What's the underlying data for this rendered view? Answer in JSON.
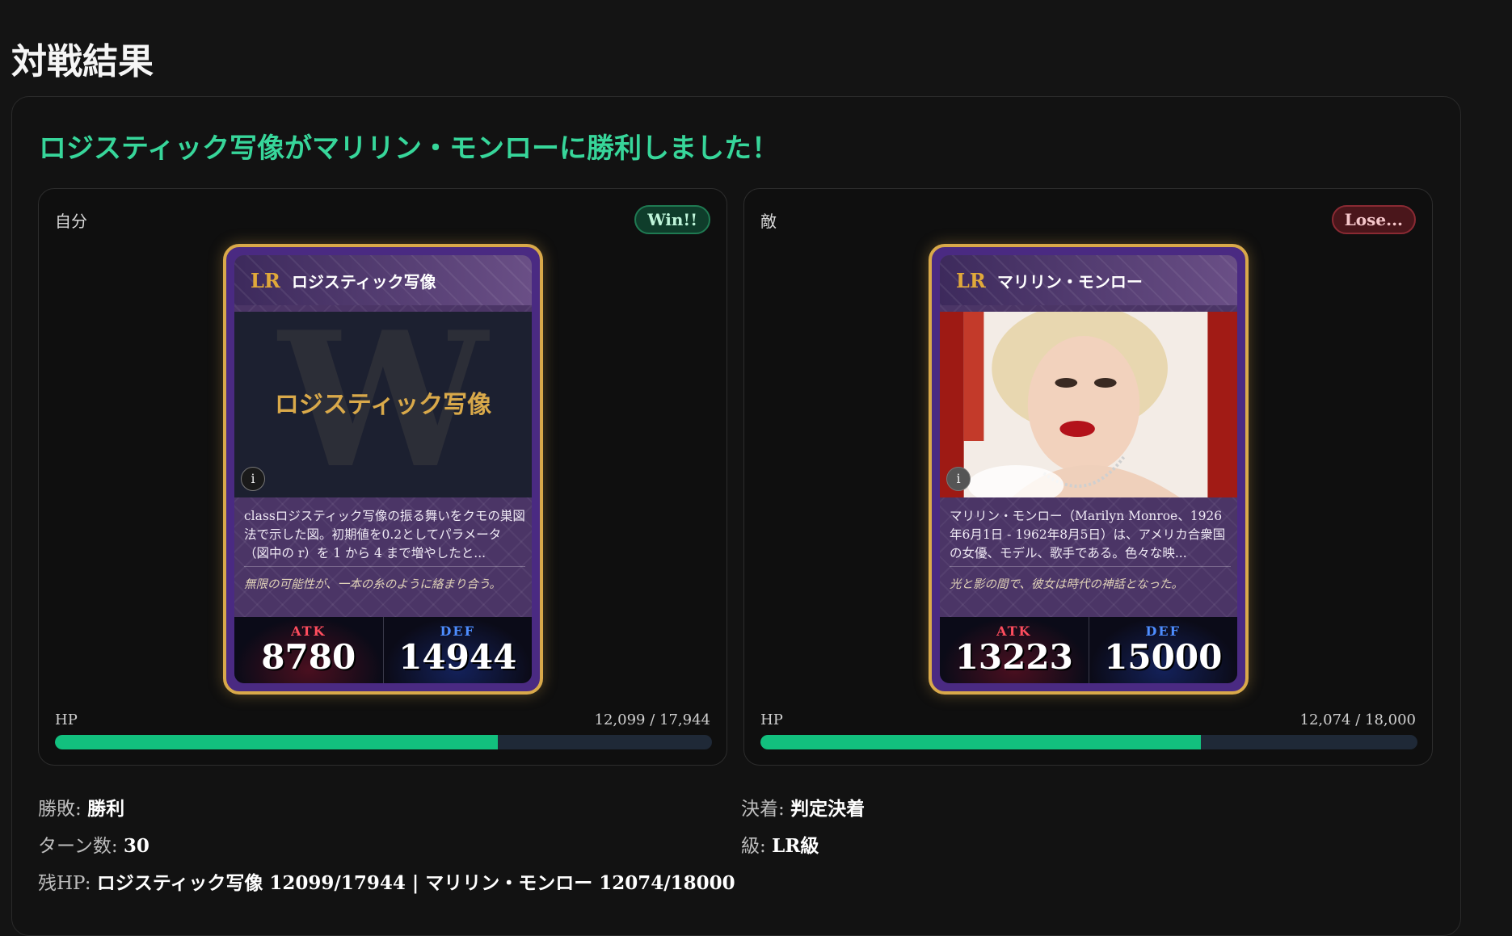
{
  "page": {
    "title": "対戦結果"
  },
  "result": {
    "headline": "ロジスティック写像がマリリン・モンローに勝利しました！"
  },
  "mine": {
    "side_label": "自分",
    "badge": "Win!!",
    "card": {
      "rarity": "LR",
      "name": "ロジスティック写像",
      "art_letter": "W",
      "art_title": "ロジスティック写像",
      "info": "i",
      "description": "classロジスティック写像の振る舞いをクモの巣図法で示した図。初期値を0.2としてパラメータ（図中の r）を 1 から 4 まで増やしたと...",
      "flavor": "無限の可能性が、一本の糸のように絡まり合う。",
      "atk_label": "ATK",
      "atk": "8780",
      "def_label": "DEF",
      "def": "14944"
    },
    "hp": {
      "label": "HP",
      "text": "12,099 / 17,944",
      "fraction": 0.6742
    }
  },
  "enemy": {
    "side_label": "敵",
    "badge": "Lose...",
    "card": {
      "rarity": "LR",
      "name": "マリリン・モンロー",
      "info": "i",
      "description": "マリリン・モンロー（Marilyn Monroe、1926年6月1日 - 1962年8月5日）は、アメリカ合衆国の女優、モデル、歌手である。色々な映...",
      "flavor": "光と影の間で、彼女は時代の神話となった。",
      "atk_label": "ATK",
      "atk": "13223",
      "def_label": "DEF",
      "def": "15000"
    },
    "hp": {
      "label": "HP",
      "text": "12,074 / 18,000",
      "fraction": 0.6708
    }
  },
  "summary": {
    "outcome_label": "勝敗: ",
    "outcome_value": "勝利",
    "settle_label": "決着: ",
    "settle_value": "判定決着",
    "turns_label": "ターン数: ",
    "turns_value": "30",
    "rank_label": "級: ",
    "rank_value": "LR級",
    "remaining_label": "残HP: ",
    "remaining_value": "ロジスティック写像 12099/17944 | マリリン・モンロー 12074/18000"
  },
  "colors": {
    "accent_green": "#37d69a",
    "hp_fill": "#12c07e",
    "card_border": "#d9a94a"
  }
}
